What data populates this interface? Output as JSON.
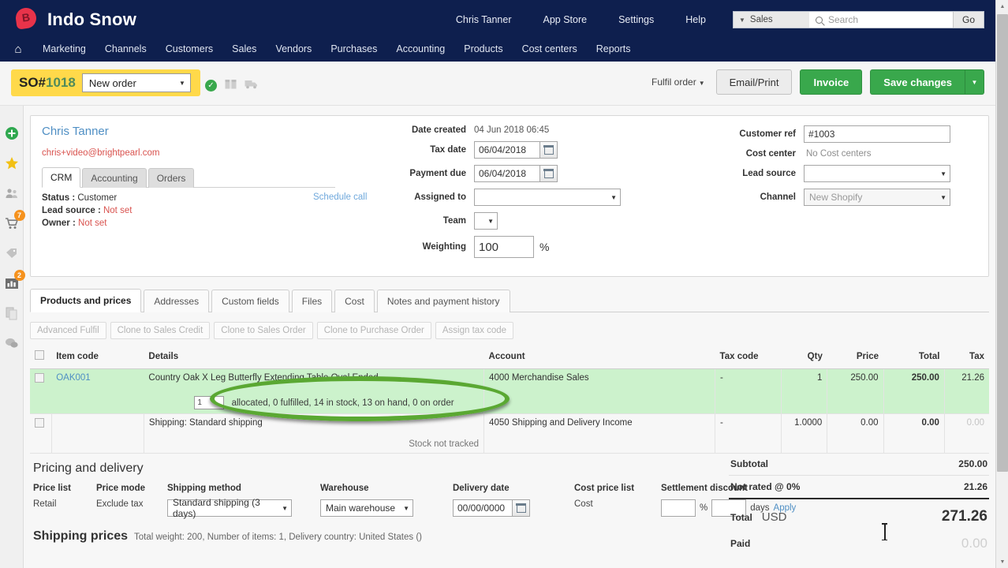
{
  "brand": {
    "name": "Indo Snow",
    "logo_icon": "brightpearl-logo-icon"
  },
  "topnav": {
    "links": [
      {
        "label": "Chris Tanner"
      },
      {
        "label": "App Store"
      },
      {
        "label": "Settings"
      },
      {
        "label": "Help"
      }
    ],
    "search": {
      "scope": "Sales",
      "placeholder": "Search",
      "value": "",
      "go_label": "Go",
      "icon": "search-icon"
    }
  },
  "mainnav": {
    "home_icon": "home-icon",
    "items": [
      {
        "label": "Marketing"
      },
      {
        "label": "Channels"
      },
      {
        "label": "Customers"
      },
      {
        "label": "Sales"
      },
      {
        "label": "Vendors"
      },
      {
        "label": "Purchases"
      },
      {
        "label": "Accounting"
      },
      {
        "label": "Products"
      },
      {
        "label": "Cost centers"
      },
      {
        "label": "Reports"
      }
    ]
  },
  "leftrail": {
    "items": [
      {
        "icon": "add-circle-icon",
        "badge": ""
      },
      {
        "icon": "star-icon",
        "badge": ""
      },
      {
        "icon": "contacts-icon",
        "badge": ""
      },
      {
        "icon": "shopping-cart-icon",
        "badge": "7"
      },
      {
        "icon": "tag-icon",
        "badge": ""
      },
      {
        "icon": "bar-chart-icon",
        "badge": "2"
      },
      {
        "icon": "documents-icon",
        "badge": ""
      },
      {
        "icon": "chat-icon",
        "badge": ""
      }
    ]
  },
  "orderbar": {
    "so_prefix": "SO#",
    "so_number": "1018",
    "status_value": "New order",
    "status_icons": [
      {
        "icon": "check-circle-icon"
      },
      {
        "icon": "package-box-icon"
      },
      {
        "icon": "delivery-truck-icon"
      }
    ],
    "fulfil_label": "Fulfil order",
    "email_print_label": "Email/Print",
    "invoice_label": "Invoice",
    "save_label": "Save changes"
  },
  "customer": {
    "name": "Chris Tanner",
    "email": "chris+video@brightpearl.com",
    "tabs": [
      {
        "label": "CRM",
        "active": true
      },
      {
        "label": "Accounting",
        "active": false
      },
      {
        "label": "Orders",
        "active": false
      }
    ],
    "status_label": "Status :",
    "status_value": "Customer",
    "lead_source_label": "Lead source :",
    "lead_source_value": "Not set",
    "owner_label": "Owner :",
    "owner_value": "Not set",
    "schedule_call_label": "Schedule call"
  },
  "order_fields": {
    "date_created_label": "Date created",
    "date_created_value": "04 Jun 2018 06:45",
    "tax_date_label": "Tax date",
    "tax_date_value": "06/04/2018",
    "payment_due_label": "Payment due",
    "payment_due_value": "06/04/2018",
    "assigned_to_label": "Assigned to",
    "assigned_to_value": "",
    "team_label": "Team",
    "team_value": "",
    "weighting_label": "Weighting",
    "weighting_value": "100",
    "weighting_unit": "%",
    "customer_ref_label": "Customer ref",
    "customer_ref_value": "#1003",
    "cost_center_label": "Cost center",
    "cost_center_value": "No Cost centers",
    "lead_source_label": "Lead source",
    "lead_source_value": "",
    "channel_label": "Channel",
    "channel_value": "New Shopify"
  },
  "tabs": [
    {
      "label": "Products and prices",
      "active": true
    },
    {
      "label": "Addresses",
      "active": false
    },
    {
      "label": "Custom fields",
      "active": false
    },
    {
      "label": "Files",
      "active": false
    },
    {
      "label": "Cost",
      "active": false
    },
    {
      "label": "Notes and payment history",
      "active": false
    }
  ],
  "action_buttons": [
    {
      "label": "Advanced Fulfil"
    },
    {
      "label": "Clone to Sales Credit"
    },
    {
      "label": "Clone to Sales Order"
    },
    {
      "label": "Clone to Purchase Order"
    },
    {
      "label": "Assign tax code"
    }
  ],
  "lines_table": {
    "columns": [
      "",
      "Item code",
      "Details",
      "Account",
      "Tax code",
      "Qty",
      "Price",
      "Total",
      "Tax"
    ],
    "rows": [
      {
        "item_code": "OAK001",
        "details": "Country Oak X Leg Butterfly Extending Table Oval Ended",
        "sub_qty": "1",
        "sub_details": "allocated, 0 fulfilled, 14 in stock, 13 on hand, 0 on order",
        "account": "4000 Merchandise Sales",
        "tax_code": "-",
        "qty": "1",
        "price": "250.00",
        "total": "250.00",
        "tax": "21.26",
        "highlight": true
      },
      {
        "item_code": "",
        "details": "Shipping: Standard shipping",
        "sub_qty": "",
        "sub_details": "Stock not tracked",
        "account": "4050 Shipping and Delivery Income",
        "tax_code": "-",
        "qty": "1.0000",
        "price": "0.00",
        "total": "0.00",
        "tax": "0.00",
        "highlight": false
      }
    ]
  },
  "totals": {
    "subtotal_label": "Subtotal",
    "subtotal_value": "250.00",
    "tax_label": "Not rated @ 0%",
    "tax_value": "21.26",
    "total_label": "Total",
    "currency": "USD",
    "total_value": "271.26",
    "paid_label": "Paid",
    "paid_value": "0.00"
  },
  "pricing": {
    "heading": "Pricing and delivery",
    "price_list_label": "Price list",
    "price_list_value": "Retail",
    "price_mode_label": "Price mode",
    "price_mode_value": "Exclude tax",
    "shipping_method_label": "Shipping method",
    "shipping_method_value": "Standard shipping (3 days)",
    "warehouse_label": "Warehouse",
    "warehouse_value": "Main warehouse",
    "delivery_date_label": "Delivery date",
    "delivery_date_value": "00/00/0000",
    "cost_price_list_label": "Cost price list",
    "cost_price_list_value": "Cost",
    "settlement_discount_label": "Settlement discount",
    "settlement_percent_value": "",
    "settlement_days_value": "",
    "percent_unit": "%",
    "days_unit": "days",
    "apply_label": "Apply"
  },
  "shipping_prices": {
    "title": "Shipping prices",
    "meta": "Total weight: 200, Number of items: 1, Delivery country: United States ()"
  },
  "colors": {
    "navy": "#0e1f4e",
    "green": "#39a84c",
    "yellow": "#ffd94a",
    "highlight_row": "#ccf2cc",
    "annotation_green": "#5aa832",
    "link_blue": "#4f8fc4",
    "red": "#d9534f",
    "badge_orange": "#f5921e"
  }
}
